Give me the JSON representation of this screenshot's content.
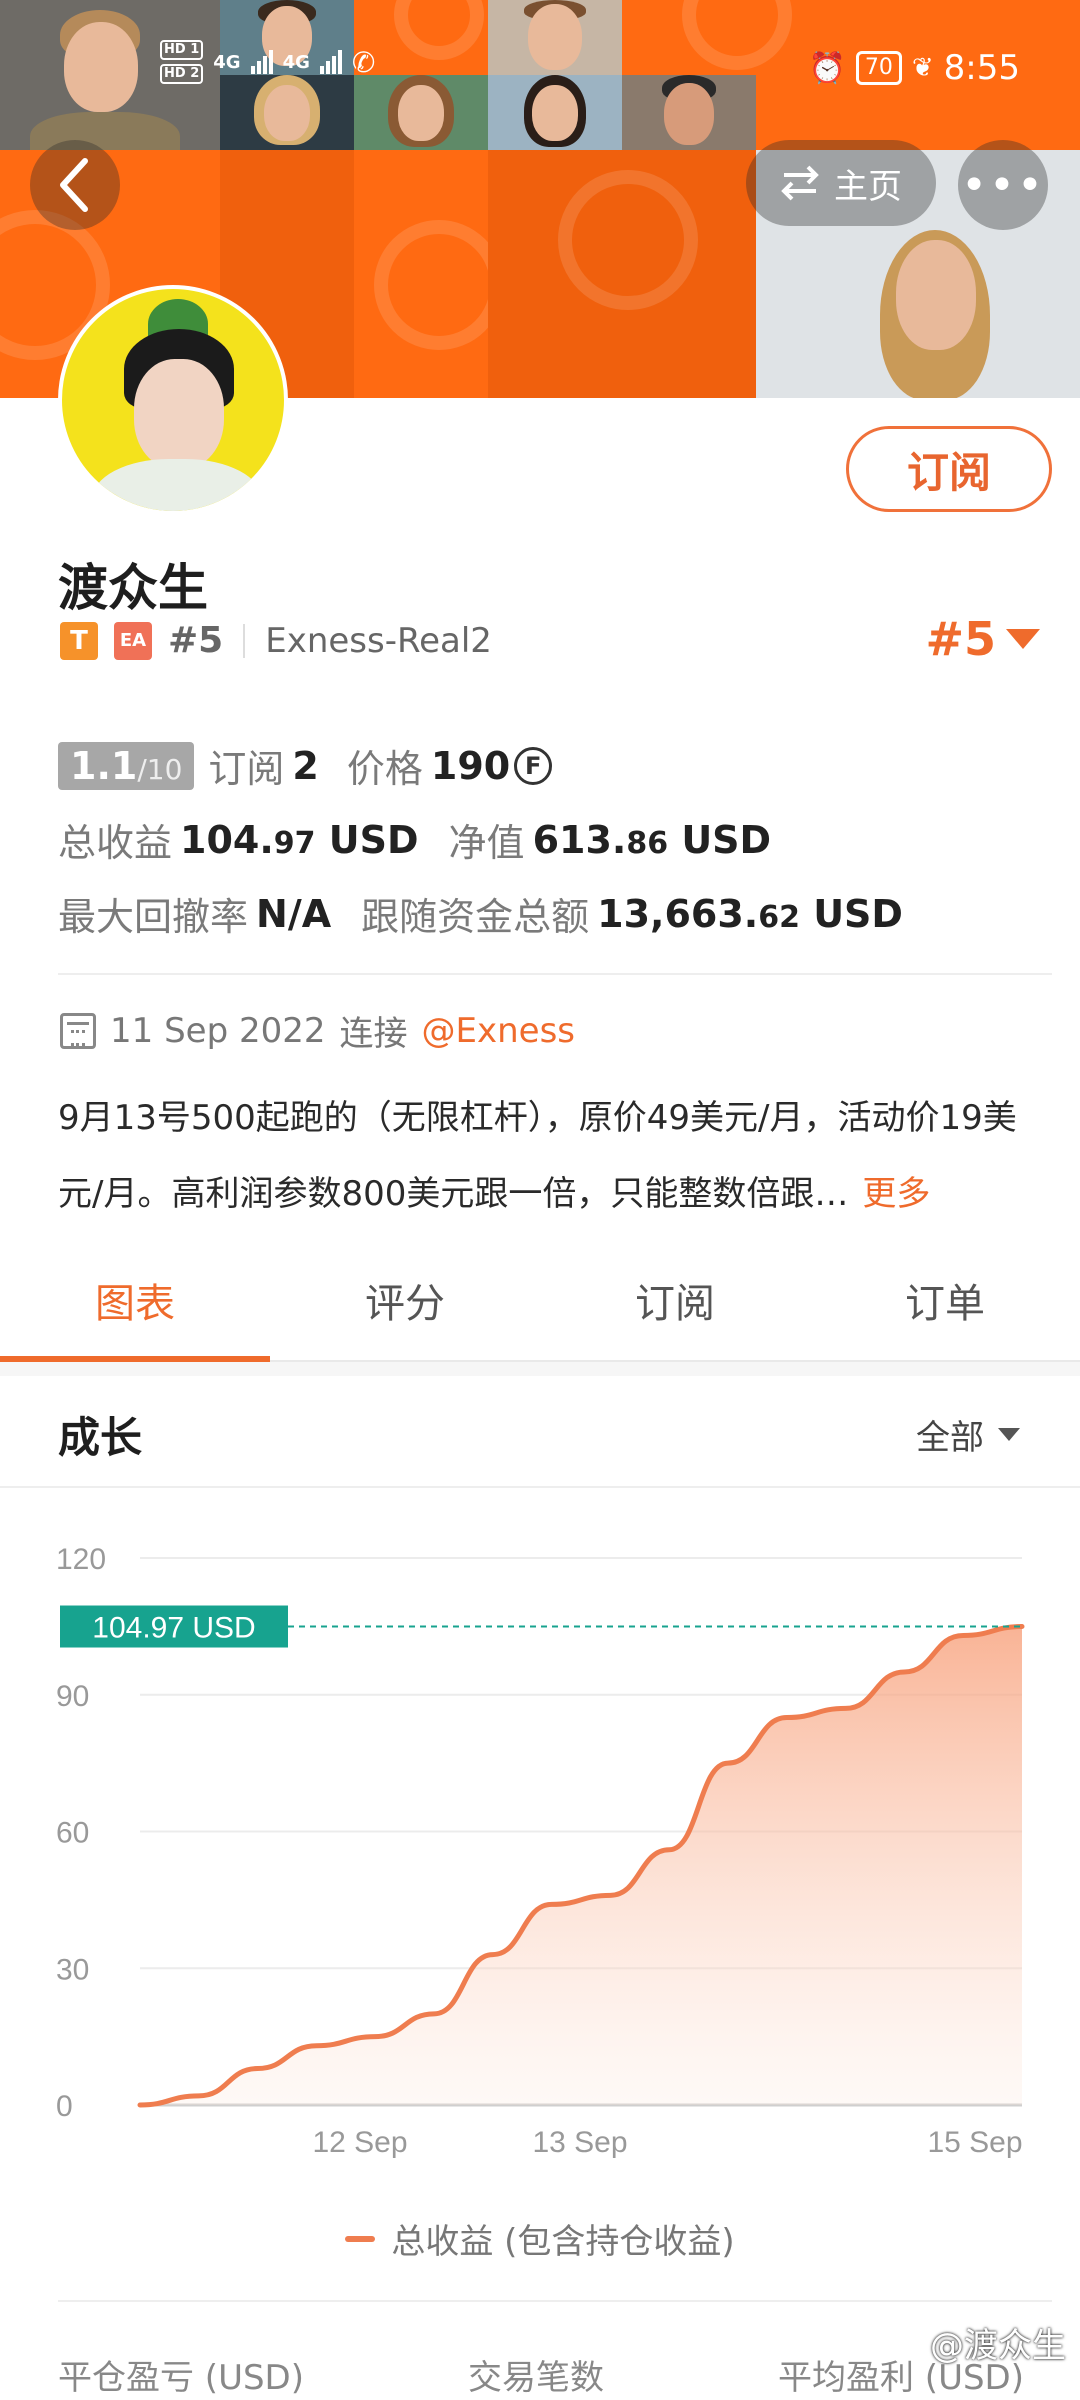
{
  "status_bar": {
    "hd1": "HD 1",
    "hd2": "HD 2",
    "net1": "4G",
    "net2": "4G",
    "battery": "70",
    "time": "8:55"
  },
  "nav": {
    "back_icon": "chevron-left-icon",
    "home_label": "主页",
    "home_icon": "swap-arrows-icon",
    "more_label": "•••"
  },
  "profile": {
    "name": "渡众生",
    "badge_t": "T",
    "badge_ea": "EA",
    "rank_small": "#5",
    "account": "Exness-Real2",
    "rank_big": "#5",
    "subscribe_label": "订阅"
  },
  "stats": {
    "score": "1.1",
    "score_max": "/10",
    "subscribe_label": "订阅",
    "subscribe_count": "2",
    "price_label": "价格",
    "price_value": "190",
    "coin_symbol": "F",
    "total_profit_label": "总收益",
    "total_profit_int": "104.",
    "total_profit_dec": "97",
    "total_profit_unit": "USD",
    "equity_label": "净值",
    "equity_int": "613.",
    "equity_dec": "86",
    "equity_unit": "USD",
    "drawdown_label": "最大回撤率",
    "drawdown_value": "N/A",
    "follow_label": "跟随资金总额",
    "follow_int": "13,663.",
    "follow_dec": "62",
    "follow_unit": "USD"
  },
  "connect": {
    "date": "11 Sep 2022",
    "text": "连接",
    "broker": "@Exness"
  },
  "description": {
    "text": "9月13号500起跑的（无限杠杆），原价49美元/月，活动价19美元/月。高利润参数800美元跟一倍，只能整数倍跟…",
    "more": "更多"
  },
  "tabs": [
    "图表",
    "评分",
    "订阅",
    "订单"
  ],
  "section": {
    "title": "成长",
    "filter": "全部"
  },
  "chart_data": {
    "type": "area",
    "ylim": [
      0,
      120
    ],
    "yticks": [
      "120",
      "90",
      "60",
      "30",
      "0"
    ],
    "yticks_values": [
      120,
      90,
      60,
      30,
      0
    ],
    "xticks": [
      "12 Sep",
      "13 Sep",
      "15 Sep"
    ],
    "series": [
      {
        "name": "总收益 (包含持仓收益)",
        "values": [
          0,
          2,
          8,
          13,
          15,
          20,
          33,
          44,
          46,
          56,
          75,
          85,
          87,
          95,
          103,
          104.97
        ]
      }
    ],
    "last_value_label": "104.97 USD",
    "line_color": "#ef7d4f",
    "grid": true
  },
  "legend": {
    "label": "总收益 (包含持仓收益)"
  },
  "bottom_columns": [
    "平仓盈亏 (USD)",
    "交易笔数",
    "平均盈利 (USD)"
  ],
  "watermark": "@渡众生"
}
